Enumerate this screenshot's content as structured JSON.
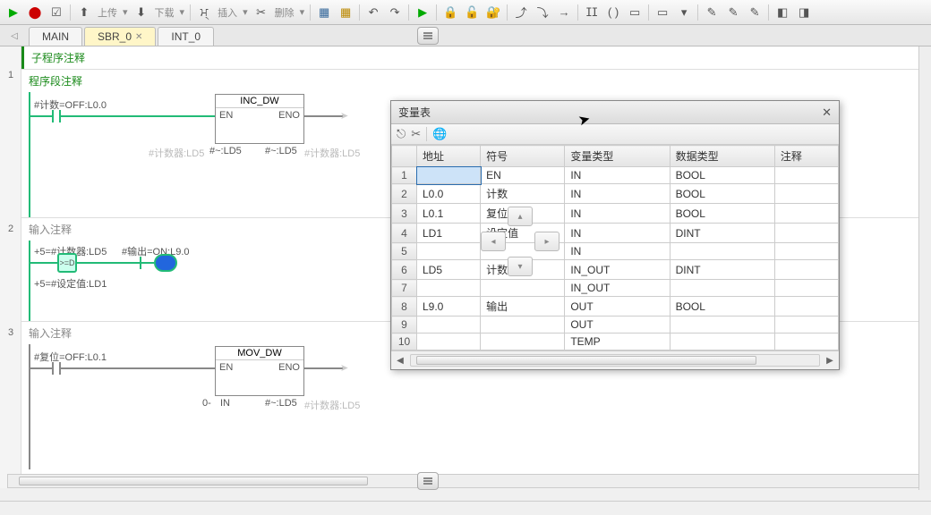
{
  "toolbar": {
    "upload": "上传",
    "download": "下载",
    "insert": "插入",
    "delete": "删除"
  },
  "tabs": {
    "main": "MAIN",
    "sbr": "SBR_0",
    "int": "INT_0"
  },
  "editor": {
    "subroutine_comment": "子程序注释",
    "net1": {
      "num": "1",
      "title": "程序段注释",
      "contact_label": "#计数=OFF:L0.0",
      "fbox_title": "INC_DW",
      "en": "EN",
      "eno": "ENO",
      "in_left": "#~:LD5",
      "in_right": "#~:LD5",
      "ghost1": "#计数器:LD5",
      "ghost2": "#计数器:LD5"
    },
    "net2": {
      "num": "2",
      "title": "输入注释",
      "line1a": "+5=#计数器:LD5",
      "line1b": "#输出=ON:L9.0",
      "cmp": ">=D",
      "line2": "+5=#设定值:LD1"
    },
    "net3": {
      "num": "3",
      "title": "输入注释",
      "contact_label": "#复位=OFF:L0.1",
      "fbox_title": "MOV_DW",
      "en": "EN",
      "eno": "ENO",
      "in_left": "0-",
      "in_mid": "IN",
      "in_right": "#~:LD5",
      "ghost": "#计数器:LD5"
    }
  },
  "dialog": {
    "title": "变量表",
    "headers": {
      "addr": "地址",
      "sym": "符号",
      "vtype": "变量类型",
      "dtype": "数据类型",
      "comment": "注释"
    },
    "rows": [
      {
        "n": "1",
        "addr": "",
        "sym": "EN",
        "vt": "IN",
        "dt": "BOOL",
        "c": ""
      },
      {
        "n": "2",
        "addr": "L0.0",
        "sym": "计数",
        "vt": "IN",
        "dt": "BOOL",
        "c": ""
      },
      {
        "n": "3",
        "addr": "L0.1",
        "sym": "复位",
        "vt": "IN",
        "dt": "BOOL",
        "c": ""
      },
      {
        "n": "4",
        "addr": "LD1",
        "sym": "设定值",
        "vt": "IN",
        "dt": "DINT",
        "c": ""
      },
      {
        "n": "5",
        "addr": "",
        "sym": "",
        "vt": "IN",
        "dt": "",
        "c": ""
      },
      {
        "n": "6",
        "addr": "LD5",
        "sym": "计数器",
        "vt": "IN_OUT",
        "dt": "DINT",
        "c": ""
      },
      {
        "n": "7",
        "addr": "",
        "sym": "",
        "vt": "IN_OUT",
        "dt": "",
        "c": ""
      },
      {
        "n": "8",
        "addr": "L9.0",
        "sym": "输出",
        "vt": "OUT",
        "dt": "BOOL",
        "c": ""
      },
      {
        "n": "9",
        "addr": "",
        "sym": "",
        "vt": "OUT",
        "dt": "",
        "c": ""
      },
      {
        "n": "10",
        "addr": "",
        "sym": "",
        "vt": "TEMP",
        "dt": "",
        "c": ""
      }
    ]
  }
}
